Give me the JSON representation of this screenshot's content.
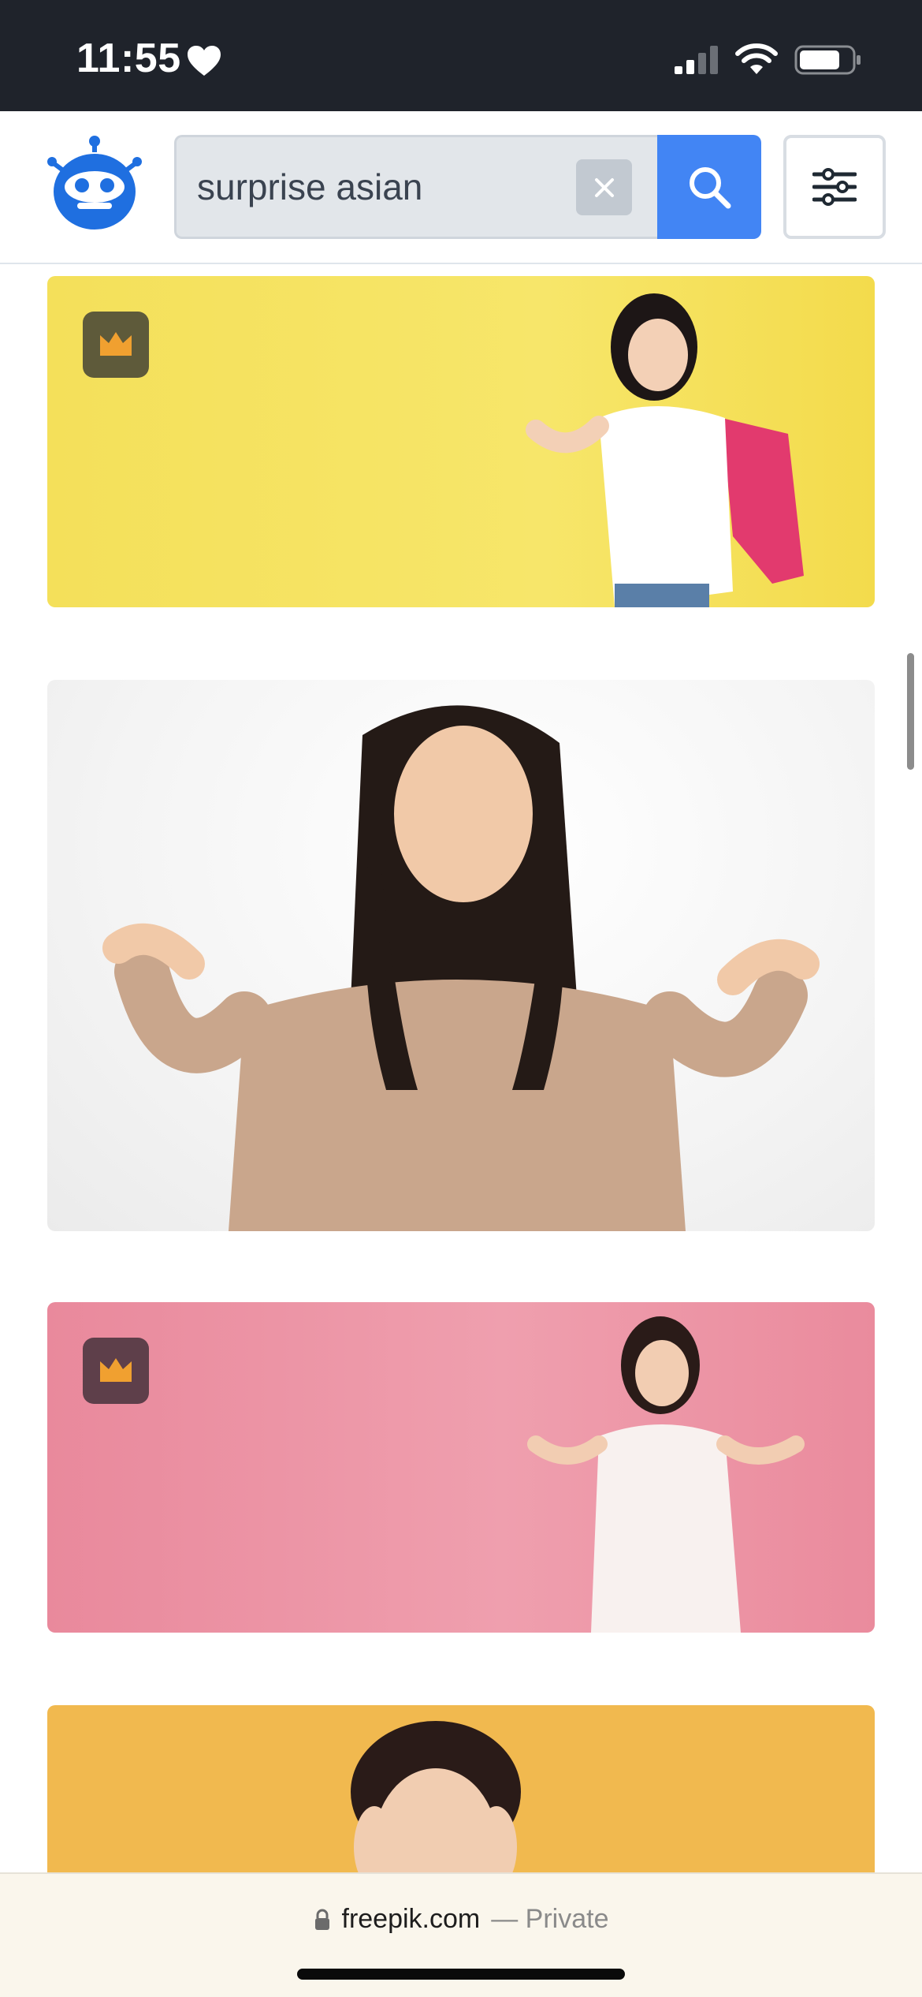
{
  "status_bar": {
    "time": "11:55",
    "icons": [
      "heart-icon",
      "cellular-signal-icon",
      "wifi-icon",
      "battery-icon"
    ]
  },
  "header": {
    "logo": "robot-logo-icon",
    "search": {
      "value": "surprise asian",
      "clear_icon": "close-icon",
      "submit_icon": "search-icon"
    },
    "filter_icon": "sliders-icon"
  },
  "results": [
    {
      "background": "yellow",
      "premium": true,
      "badge_icon": "crown-icon"
    },
    {
      "background": "white",
      "premium": false
    },
    {
      "background": "pink",
      "premium": true,
      "badge_icon": "crown-icon"
    },
    {
      "background": "orange",
      "premium": false
    }
  ],
  "browser_bar": {
    "domain": "freepik.com",
    "suffix": "— Private"
  },
  "colors": {
    "accent_blue": "#4285f4",
    "status_bar_bg": "#1f232b",
    "crown": "#f0a030"
  }
}
